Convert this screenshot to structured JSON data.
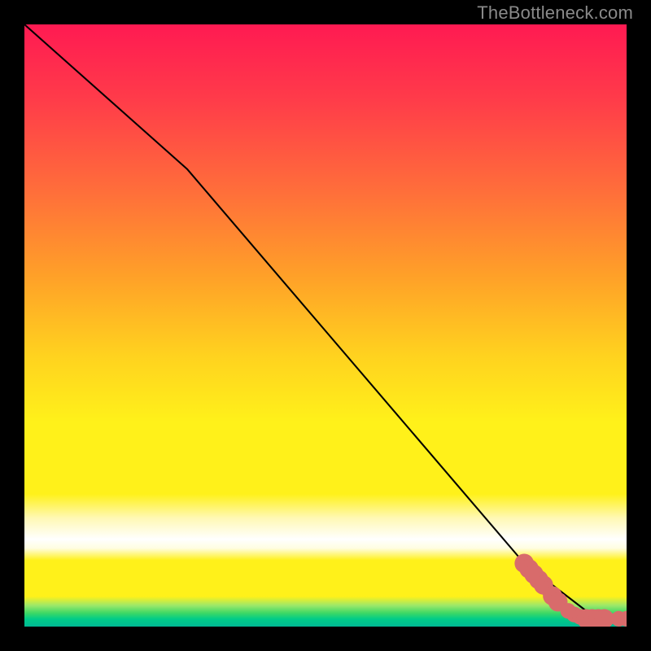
{
  "attribution": "TheBottleneck.com",
  "chart_data": {
    "type": "line",
    "title": "",
    "xlabel": "",
    "ylabel": "",
    "xlim": [
      0,
      100
    ],
    "ylim": [
      0,
      100
    ],
    "curve": {
      "name": "bottleneck-curve",
      "points": [
        {
          "x": 0,
          "y": 100
        },
        {
          "x": 27,
          "y": 76
        },
        {
          "x": 83,
          "y": 10.5
        },
        {
          "x": 95,
          "y": 1.3
        },
        {
          "x": 100,
          "y": 1.3
        }
      ]
    },
    "markers": {
      "name": "highlighted-segment",
      "color": "#d86b6b",
      "points": [
        {
          "x": 83.0,
          "y": 10.5,
          "r": 1.6
        },
        {
          "x": 83.8,
          "y": 9.6,
          "r": 1.6
        },
        {
          "x": 84.6,
          "y": 8.7,
          "r": 1.6
        },
        {
          "x": 85.4,
          "y": 7.8,
          "r": 1.6
        },
        {
          "x": 86.2,
          "y": 6.9,
          "r": 1.6
        },
        {
          "x": 86.7,
          "y": 6.3,
          "r": 1.2
        },
        {
          "x": 87.7,
          "y": 5.1,
          "r": 1.6
        },
        {
          "x": 88.6,
          "y": 4.1,
          "r": 1.6
        },
        {
          "x": 90.3,
          "y": 2.6,
          "r": 1.3
        },
        {
          "x": 91.3,
          "y": 2.0,
          "r": 1.3
        },
        {
          "x": 92.3,
          "y": 1.6,
          "r": 1.3
        },
        {
          "x": 93.3,
          "y": 1.3,
          "r": 1.6
        },
        {
          "x": 94.3,
          "y": 1.3,
          "r": 1.6
        },
        {
          "x": 95.3,
          "y": 1.3,
          "r": 1.6
        },
        {
          "x": 96.3,
          "y": 1.3,
          "r": 1.6
        },
        {
          "x": 97.0,
          "y": 1.3,
          "r": 1.1
        },
        {
          "x": 98.7,
          "y": 1.3,
          "r": 1.3
        },
        {
          "x": 100.0,
          "y": 1.3,
          "r": 1.3
        }
      ]
    },
    "background_bands": [
      {
        "position": "top",
        "color_start": "#ff1a52",
        "color_end": "#fff11a"
      },
      {
        "position": "middle",
        "color_start": "#fff11a",
        "color_end": "#ffffff"
      },
      {
        "position": "bottom",
        "color_start": "#fff11a",
        "color_end": "#00b894"
      }
    ]
  }
}
